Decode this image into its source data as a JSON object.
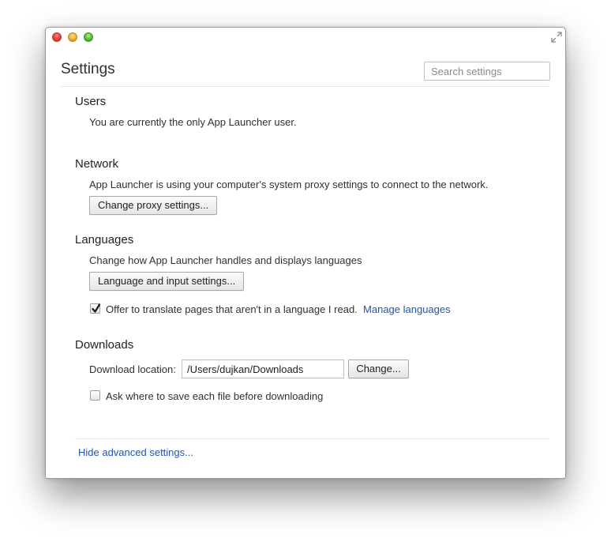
{
  "window": {
    "controls": [
      "close",
      "minimize",
      "zoom"
    ],
    "expand_icon": "expand-arrows-icon"
  },
  "header": {
    "title": "Settings",
    "search_placeholder": "Search settings"
  },
  "sections": {
    "users": {
      "title": "Users",
      "description": "You are currently the only App Launcher user."
    },
    "network": {
      "title": "Network",
      "description": "App Launcher is using your computer's system proxy settings to connect to the network.",
      "button": "Change proxy settings..."
    },
    "languages": {
      "title": "Languages",
      "description": "Change how App Launcher handles and displays languages",
      "button": "Language and input settings...",
      "translate_label": "Offer to translate pages that aren't in a language I read.",
      "translate_checked": true,
      "manage_link": "Manage languages"
    },
    "downloads": {
      "title": "Downloads",
      "location_label": "Download location:",
      "location_value": "/Users/dujkan/Downloads",
      "change_button": "Change...",
      "ask_label": "Ask where to save each file before downloading",
      "ask_checked": false
    }
  },
  "footer": {
    "hide_link": "Hide advanced settings..."
  },
  "colors": {
    "link": "#2255aa",
    "text": "#303030"
  }
}
